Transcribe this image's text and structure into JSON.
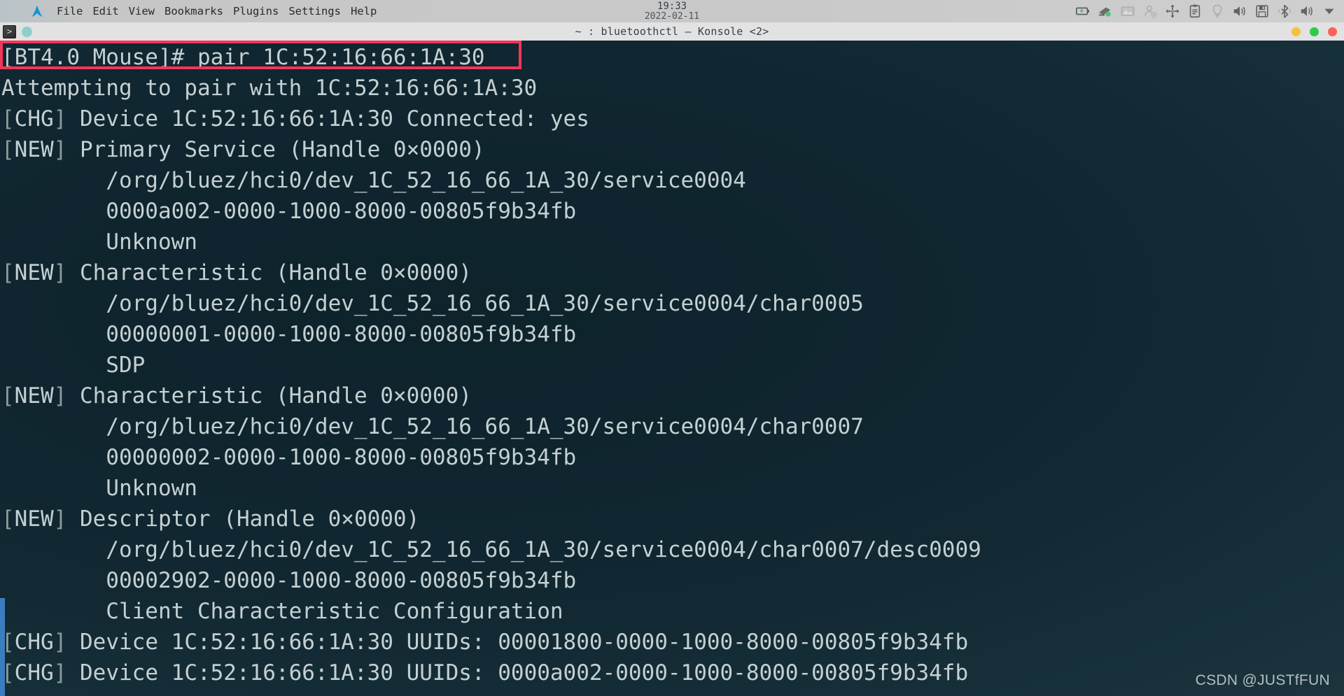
{
  "panel": {
    "logo_icon": "arch-logo-icon",
    "menus": [
      {
        "label": "File"
      },
      {
        "label": "Edit"
      },
      {
        "label": "View"
      },
      {
        "label": "Bookmarks"
      },
      {
        "label": "Plugins"
      },
      {
        "label": "Settings"
      },
      {
        "label": "Help"
      }
    ],
    "clock": {
      "time": "19:33",
      "date": "2022-02-11"
    },
    "tray": [
      {
        "name": "battery-icon"
      },
      {
        "name": "network-connected-icon"
      },
      {
        "name": "image-viewer-icon"
      },
      {
        "name": "user-offline-icon"
      },
      {
        "name": "move-arrows-icon"
      },
      {
        "name": "clipboard-icon"
      },
      {
        "name": "lightbulb-icon"
      },
      {
        "name": "volume-icon"
      },
      {
        "name": "removable-media-icon"
      },
      {
        "name": "bluetooth-icon"
      },
      {
        "name": "volume-icon"
      },
      {
        "name": "chevron-down-icon"
      }
    ]
  },
  "window": {
    "app_icon": "konsole-prompt-icon",
    "status_dot": "session-active-dot",
    "title": "~ : bluetoothctl — Konsole <2>",
    "buttons": [
      {
        "name": "minimize-button",
        "color": "#f5c13b"
      },
      {
        "name": "maximize-button",
        "color": "#2ecb4b"
      },
      {
        "name": "close-button",
        "color": "#fa6259"
      }
    ]
  },
  "terminal": {
    "lines": [
      {
        "id": "prompt-command",
        "segments": [
          {
            "text": "[BT4.0 Mouse]# pair 1C:52:16:66:1A:30",
            "style": "normal"
          }
        ]
      },
      {
        "id": "output-attempting",
        "segments": [
          {
            "text": "Attempting to pair with 1C:52:16:66:1A:30",
            "style": "normal"
          }
        ]
      },
      {
        "id": "output-chg-connected",
        "segments": [
          {
            "text": "[",
            "style": "tag"
          },
          {
            "text": "CHG",
            "style": "normal"
          },
          {
            "text": "]",
            "style": "tag"
          },
          {
            "text": " Device 1C:52:16:66:1A:30 Connected: yes",
            "style": "normal"
          }
        ]
      },
      {
        "id": "output-new-primary-service",
        "segments": [
          {
            "text": "[",
            "style": "tag"
          },
          {
            "text": "NEW",
            "style": "normal"
          },
          {
            "text": "]",
            "style": "tag"
          },
          {
            "text": " Primary Service (Handle 0×0000)",
            "style": "normal"
          }
        ]
      },
      {
        "id": "output-service0004-path",
        "segments": [
          {
            "text": "        /org/bluez/hci0/dev_1C_52_16_66_1A_30/service0004",
            "style": "normal"
          }
        ]
      },
      {
        "id": "output-service0004-uuid",
        "segments": [
          {
            "text": "        0000a002-0000-1000-8000-00805f9b34fb",
            "style": "normal"
          }
        ]
      },
      {
        "id": "output-service0004-name",
        "segments": [
          {
            "text": "        Unknown",
            "style": "normal"
          }
        ]
      },
      {
        "id": "output-new-characteristic-1",
        "segments": [
          {
            "text": "[",
            "style": "tag"
          },
          {
            "text": "NEW",
            "style": "normal"
          },
          {
            "text": "]",
            "style": "tag"
          },
          {
            "text": " Characteristic (Handle 0×0000)",
            "style": "normal"
          }
        ]
      },
      {
        "id": "output-char0005-path",
        "segments": [
          {
            "text": "        /org/bluez/hci0/dev_1C_52_16_66_1A_30/service0004/char0005",
            "style": "normal"
          }
        ]
      },
      {
        "id": "output-char0005-uuid",
        "segments": [
          {
            "text": "        00000001-0000-1000-8000-00805f9b34fb",
            "style": "normal"
          }
        ]
      },
      {
        "id": "output-char0005-name",
        "segments": [
          {
            "text": "        SDP",
            "style": "normal"
          }
        ]
      },
      {
        "id": "output-new-characteristic-2",
        "segments": [
          {
            "text": "[",
            "style": "tag"
          },
          {
            "text": "NEW",
            "style": "normal"
          },
          {
            "text": "]",
            "style": "tag"
          },
          {
            "text": " Characteristic (Handle 0×0000)",
            "style": "normal"
          }
        ]
      },
      {
        "id": "output-char0007-path",
        "segments": [
          {
            "text": "        /org/bluez/hci0/dev_1C_52_16_66_1A_30/service0004/char0007",
            "style": "normal"
          }
        ]
      },
      {
        "id": "output-char0007-uuid",
        "segments": [
          {
            "text": "        00000002-0000-1000-8000-00805f9b34fb",
            "style": "normal"
          }
        ]
      },
      {
        "id": "output-char0007-name",
        "segments": [
          {
            "text": "        Unknown",
            "style": "normal"
          }
        ]
      },
      {
        "id": "output-new-descriptor",
        "segments": [
          {
            "text": "[",
            "style": "tag"
          },
          {
            "text": "NEW",
            "style": "normal"
          },
          {
            "text": "]",
            "style": "tag"
          },
          {
            "text": " Descriptor (Handle 0×0000)",
            "style": "normal"
          }
        ]
      },
      {
        "id": "output-desc0009-path",
        "segments": [
          {
            "text": "        /org/bluez/hci0/dev_1C_52_16_66_1A_30/service0004/char0007/desc0009",
            "style": "normal"
          }
        ]
      },
      {
        "id": "output-desc0009-uuid",
        "segments": [
          {
            "text": "        00002902-0000-1000-8000-00805f9b34fb",
            "style": "normal"
          }
        ]
      },
      {
        "id": "output-desc0009-name",
        "segments": [
          {
            "text": "        Client Characteristic Configuration",
            "style": "normal"
          }
        ]
      },
      {
        "id": "output-chg-uuids-1800",
        "segments": [
          {
            "text": "[",
            "style": "tag"
          },
          {
            "text": "CHG",
            "style": "normal"
          },
          {
            "text": "]",
            "style": "tag"
          },
          {
            "text": " Device 1C:52:16:66:1A:30 UUIDs: 00001800-0000-1000-8000-00805f9b34fb",
            "style": "normal"
          }
        ]
      },
      {
        "id": "output-chg-uuids-a002",
        "segments": [
          {
            "text": "[",
            "style": "tag"
          },
          {
            "text": "CHG",
            "style": "normal"
          },
          {
            "text": "]",
            "style": "tag"
          },
          {
            "text": " Device 1C:52:16:66:1A:30 UUIDs: 0000a002-0000-1000-8000-00805f9b34fb",
            "style": "normal"
          }
        ]
      }
    ]
  },
  "annotation": {
    "highlight_color": "#f4365a",
    "highlighted_line": "[BT4.0 Mouse]# pair 1C:52:16:66:1A:30"
  },
  "watermark": {
    "text": "CSDN @JUSTfFUN"
  }
}
